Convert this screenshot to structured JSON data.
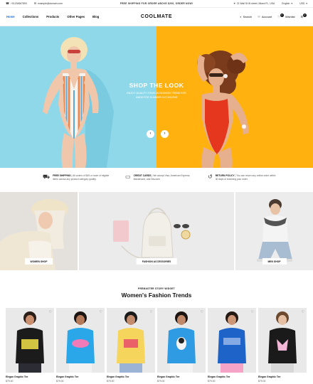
{
  "topbar": {
    "phone": "+01234567890",
    "email": "example@domain.com",
    "promo": "FREE SHIPPING FOR ORDER ABOVE $200, ORDER NOW!",
    "address": "21 Wall St W street, Miami FL, USA",
    "language": "English",
    "currency": "USD"
  },
  "nav": {
    "menu": [
      "Home",
      "Collections",
      "Products",
      "Other Pages",
      "Blog"
    ],
    "logo": "COOLMATE",
    "search_label": "Search",
    "account_label": "Account",
    "wishlist_label": "Wishlist",
    "wishlist_count": "0",
    "cart_count": "0"
  },
  "hero": {
    "title": "SHOP THE LOOK",
    "subtitle_line1": "ENJOY QUALITY ITEMS IN FASHION TREND FOR",
    "subtitle_line2": "MADE FOR SUMMER OCCASIONS",
    "prev": "‹",
    "next": "›",
    "colors": {
      "left_bg": "#8fd8ea",
      "right_bg": "#ffb20f"
    }
  },
  "features": [
    {
      "icon": "truck-icon",
      "title": "FREE SHIPPING",
      "text": "All orders of $49 or more of eligible items across any product category qualify."
    },
    {
      "icon": "card-icon",
      "title": "CREDIT CARDS",
      "text": "We accept Visa, American Express, Mastercard, and Discover"
    },
    {
      "icon": "return-icon",
      "title": "RETURN POLICY",
      "text": "You can return any online order within 30 days of receiving your order"
    }
  ],
  "categories": [
    {
      "label": "WOMEN SHOP"
    },
    {
      "label": "FASHION ACCESSORIES"
    },
    {
      "label": "MEN SHOP"
    }
  ],
  "section": {
    "eyebrow": "PREMASTER STORY WIDGET",
    "title": "Women's Fashion Trends"
  },
  "products": [
    {
      "name": "Elegan Graphic Tee",
      "price": "$79.00",
      "shirt": "#1b1b1b"
    },
    {
      "name": "Elegan Graphic Tee",
      "price": "$79.00",
      "shirt": "#2aa7e8"
    },
    {
      "name": "Elegan Graphic Tee",
      "price": "$79.00",
      "shirt": "#f6d55c"
    },
    {
      "name": "Elegan Graphic Tee",
      "price": "$79.00",
      "shirt": "#2f9be3"
    },
    {
      "name": "Elegan Graphic Tee",
      "price": "$79.00",
      "shirt": "#1e63c7"
    },
    {
      "name": "Elegan Graphic Tee",
      "price": "$79.00",
      "shirt": "#1a1a1a"
    }
  ]
}
